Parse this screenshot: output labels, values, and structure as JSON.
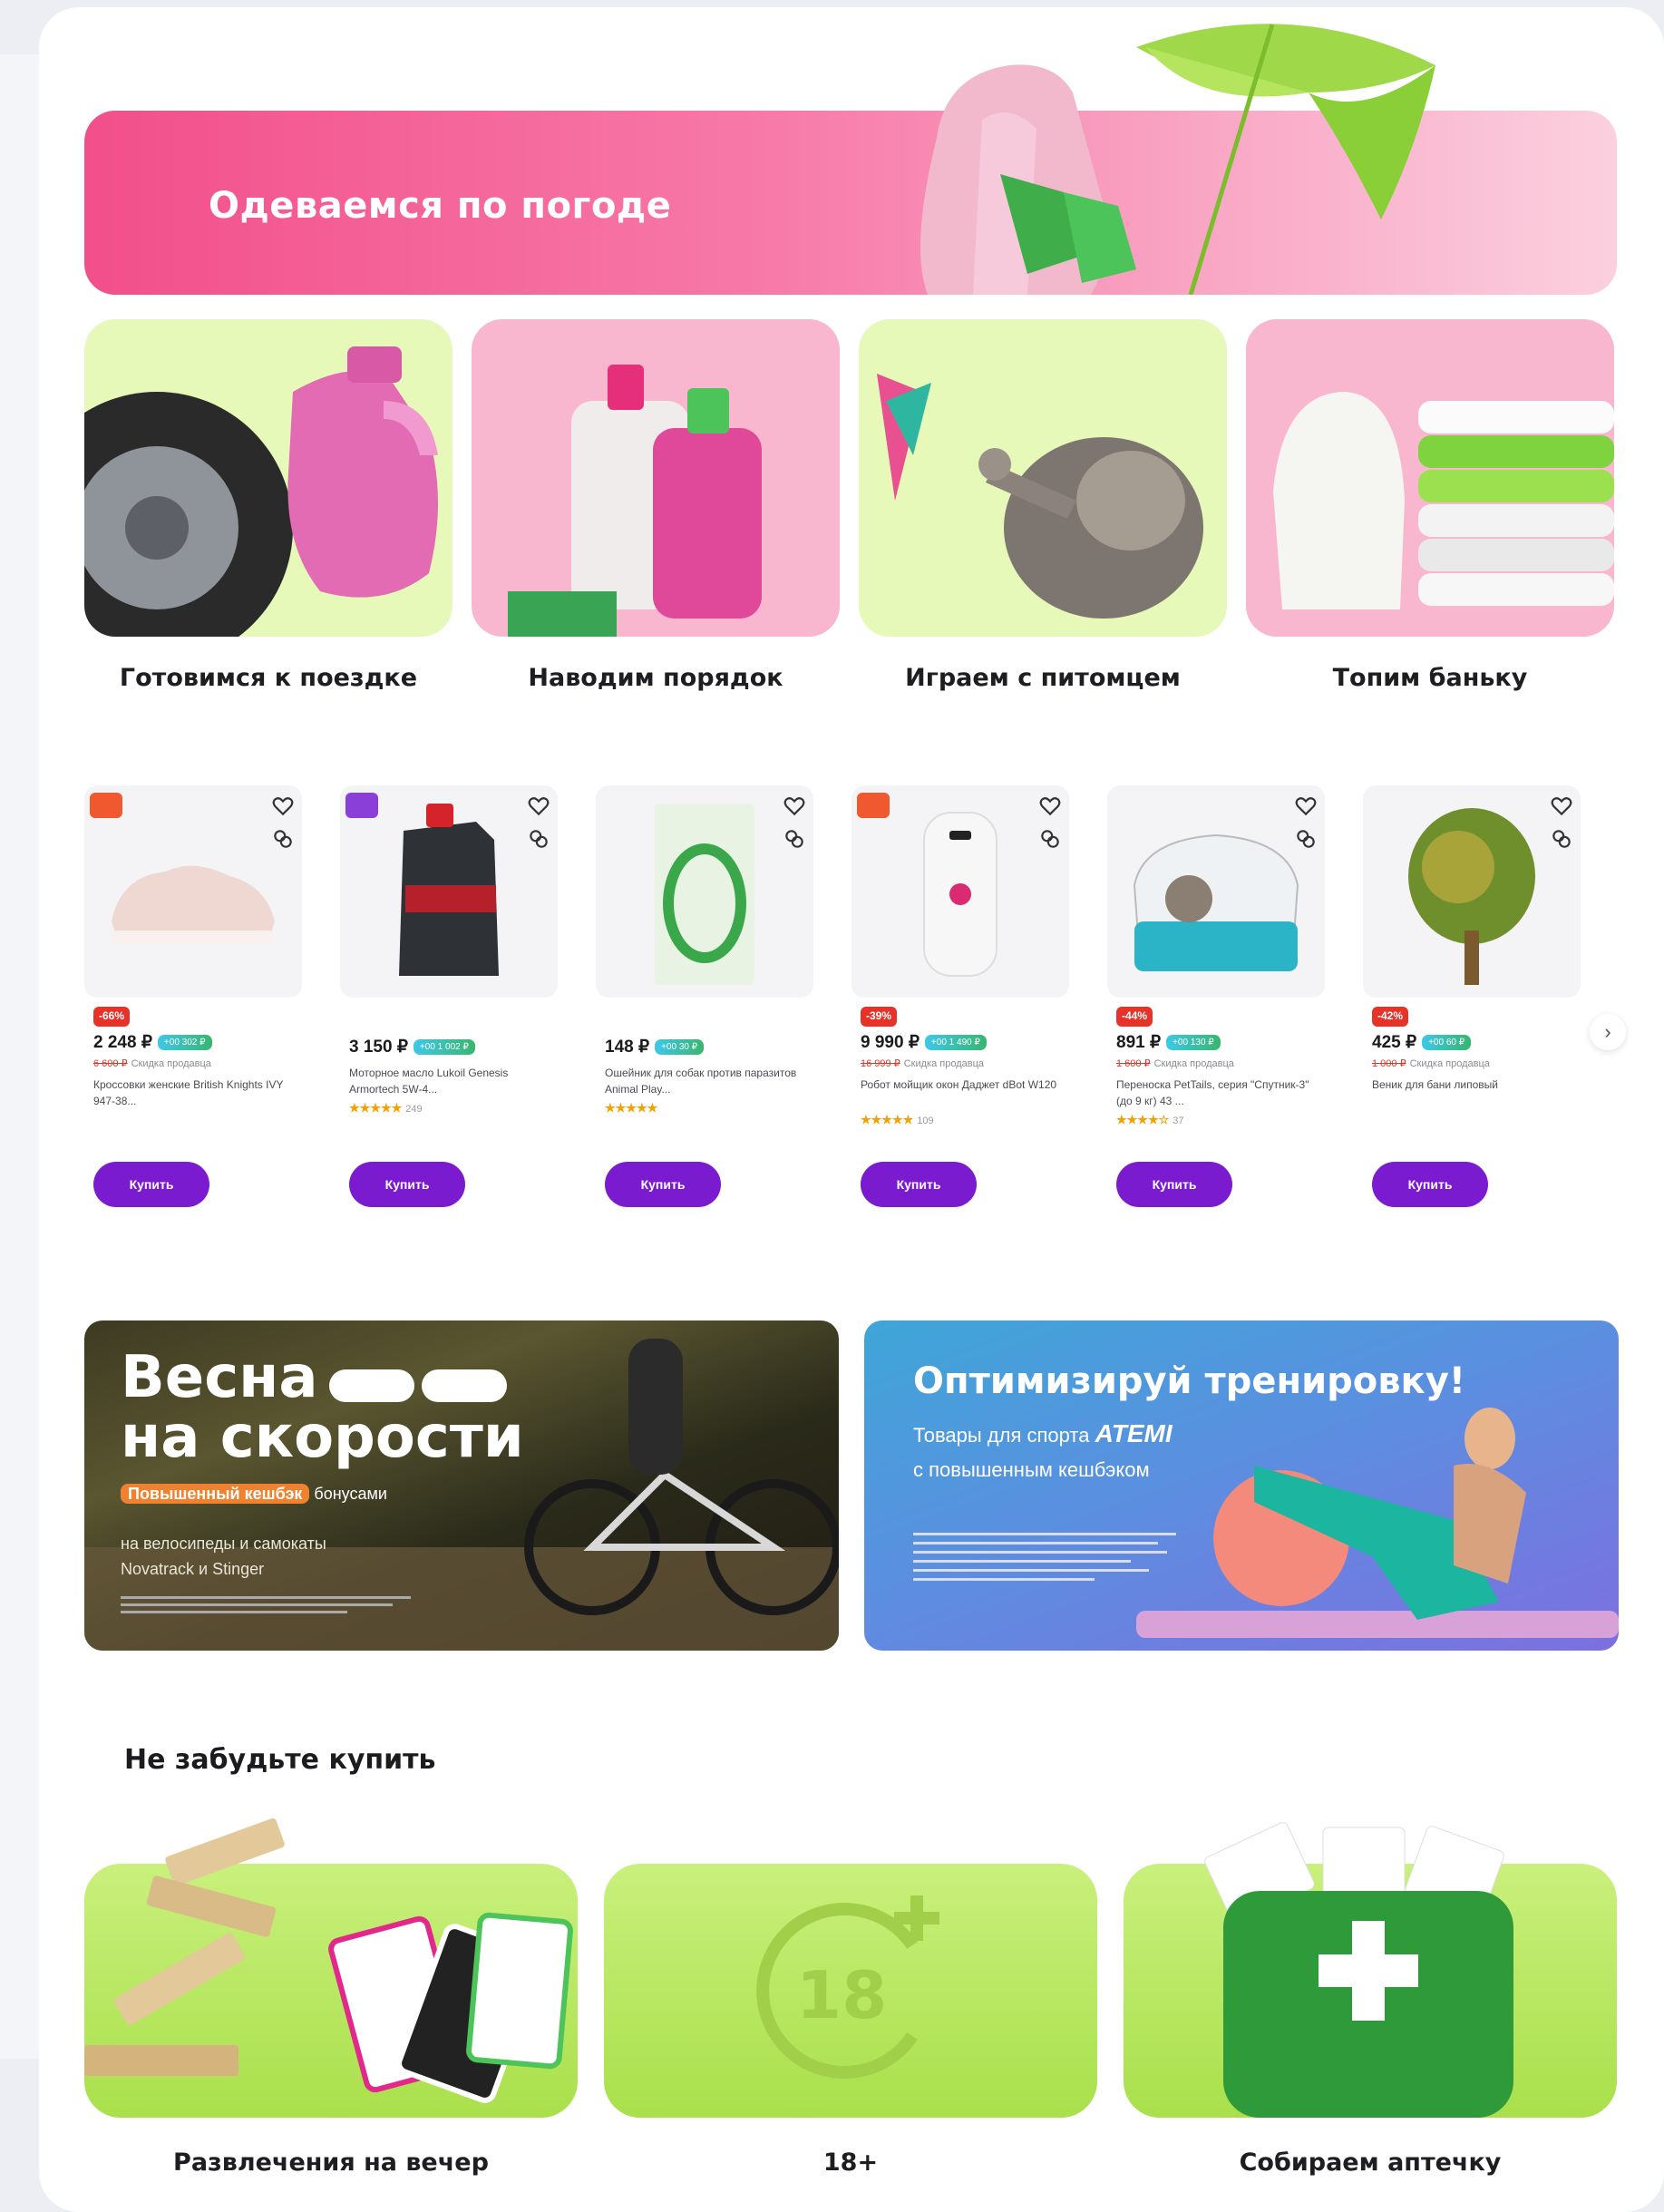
{
  "hero": {
    "title": "Одеваемся по погоде"
  },
  "categories": [
    {
      "label": "Готовимся к поездке"
    },
    {
      "label": "Наводим порядок"
    },
    {
      "label": "Играем с питомцем"
    },
    {
      "label": "Топим баньку"
    }
  ],
  "products": [
    {
      "discount": "-66%",
      "price": "2 248 ₽",
      "bonus": "+00 302 ₽",
      "old": "6 600 ₽",
      "note": "Скидка продавца",
      "title": "Кроссовки женские British Knights IVY 947-38...",
      "stars": "",
      "reviews": "",
      "buy": "Купить"
    },
    {
      "discount": "",
      "price": "3 150 ₽",
      "bonus": "+00 1 002 ₽",
      "old": "",
      "note": "",
      "title": "Моторное масло Lukoil Genesis Armortech 5W-4...",
      "stars": "★★★★★",
      "reviews": "249",
      "buy": "Купить"
    },
    {
      "discount": "",
      "price": "148 ₽",
      "bonus": "+00 30 ₽",
      "old": "",
      "note": "",
      "title": "Ошейник для собак против паразитов Animal Play...",
      "stars": "★★★★★",
      "reviews": "",
      "buy": "Купить"
    },
    {
      "discount": "-39%",
      "price": "9 990 ₽",
      "bonus": "+00 1 490 ₽",
      "old": "16 999 ₽",
      "note": "Скидка продавца",
      "title": "Робот мойщик окон Даджет dBot W120",
      "stars": "★★★★★",
      "reviews": "109",
      "buy": "Купить"
    },
    {
      "discount": "-44%",
      "price": "891 ₽",
      "bonus": "+00 130 ₽",
      "old": "1 600 ₽",
      "note": "Скидка продавца",
      "title": "Переноска PetTails, серия \"Спутник-3\" (до 9 кг) 43 ...",
      "stars": "★★★★☆",
      "reviews": "37",
      "buy": "Купить"
    },
    {
      "discount": "-42%",
      "price": "425 ₽",
      "bonus": "+00 60 ₽",
      "old": "1 000 ₽",
      "note": "Скидка продавца",
      "title": "Веник для бани липовый",
      "stars": "",
      "reviews": "",
      "buy": "Купить"
    }
  ],
  "promos": {
    "bike": {
      "line1": "Весна",
      "line2": "на скорости",
      "highlight": "Повышенный кешбэк",
      "rest": " бонусами",
      "sub1": "на велосипеды и самокаты",
      "sub2": "Novatrack и Stinger"
    },
    "sport": {
      "title": "Оптимизируй тренировку!",
      "line1": "Товары для спорта",
      "brand": "ATEMI",
      "line2": "с повышенным кешбэком"
    }
  },
  "section": {
    "title": "Не забудьте купить"
  },
  "collections": [
    {
      "label": "Развлечения на вечер"
    },
    {
      "label": "18+",
      "badge": "18"
    },
    {
      "label": "Собираем аптечку"
    }
  ],
  "colors": {
    "accent": "#7a1bd0",
    "hero_pink": "#f24f8a",
    "lime": "#c9f07c",
    "discount": "#e6332a"
  }
}
